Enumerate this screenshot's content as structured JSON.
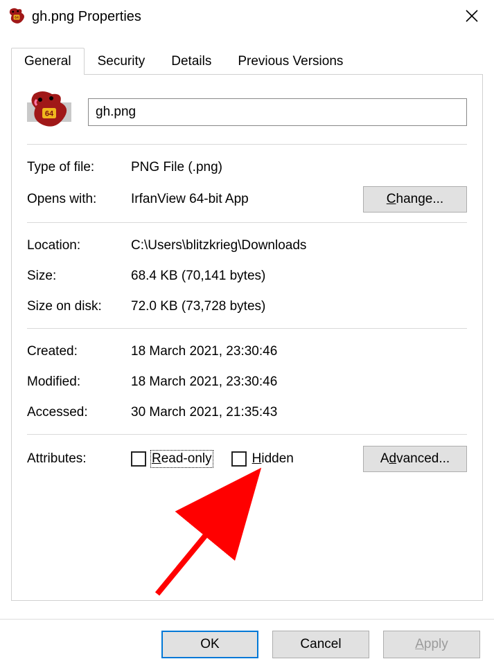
{
  "title": "gh.png Properties",
  "tabs": [
    "General",
    "Security",
    "Details",
    "Previous Versions"
  ],
  "filename": "gh.png",
  "fields": {
    "type_of_file": {
      "label": "Type of file:",
      "value": "PNG File (.png)"
    },
    "opens_with": {
      "label": "Opens with:",
      "value": "IrfanView 64-bit App"
    },
    "location": {
      "label": "Location:",
      "value": "C:\\Users\\blitzkrieg\\Downloads"
    },
    "size": {
      "label": "Size:",
      "value": "68.4 KB (70,141 bytes)"
    },
    "size_on_disk": {
      "label": "Size on disk:",
      "value": "72.0 KB (73,728 bytes)"
    },
    "created": {
      "label": "Created:",
      "value": "18 March 2021, 23:30:46"
    },
    "modified": {
      "label": "Modified:",
      "value": "18 March 2021, 23:30:46"
    },
    "accessed": {
      "label": "Accessed:",
      "value": "30 March 2021, 21:35:43"
    }
  },
  "attributes_label": "Attributes:",
  "attributes": {
    "read_only": "Read-only",
    "hidden": "Hidden"
  },
  "buttons": {
    "change": "Change...",
    "advanced": "Advanced...",
    "ok": "OK",
    "cancel": "Cancel",
    "apply": "Apply"
  }
}
